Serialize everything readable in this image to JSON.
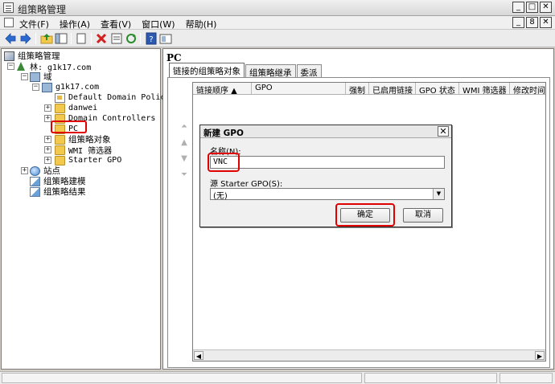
{
  "window": {
    "title": "组策略管理"
  },
  "menu": [
    "文件(F)",
    "操作(A)",
    "查看(V)",
    "窗口(W)",
    "帮助(H)"
  ],
  "window_buttons": {
    "minimize": "_",
    "maximize": "□",
    "close": "✕",
    "restore": "8"
  },
  "tree": {
    "root": "组策略管理",
    "forest": "林: g1k17.com",
    "domains": "域",
    "domain": "g1k17.com",
    "default_policy": "Default Domain Policy",
    "ou_danwei": "danwei",
    "ou_dc": "Domain Controllers",
    "ou_pc": "PC",
    "gpo_objects": "组策略对象",
    "wmi_filters": "WMI 筛选器",
    "starter_gpo": "Starter GPO",
    "sites": "站点",
    "modeling": "组策略建模",
    "results": "组策略结果",
    "expand_plus": "+",
    "expand_minus": "−"
  },
  "right": {
    "title": "PC",
    "tabs": [
      "链接的组策略对象",
      "组策略继承",
      "委派"
    ],
    "columns": [
      "链接顺序 ▲",
      "GPO",
      "强制",
      "已启用链接",
      "GPO 状态",
      "WMI 筛选器",
      "修改时间"
    ]
  },
  "dialog": {
    "title": "新建 GPO",
    "name_label": "名称(N):",
    "name_value": "VNC",
    "source_label": "源 Starter GPO(S):",
    "source_value": "(无)",
    "ok": "确定",
    "cancel": "取消",
    "close": "✕"
  },
  "icons": {
    "back": "back-arrow-icon",
    "forward": "forward-arrow-icon",
    "delete": "delete-icon",
    "refresh": "refresh-icon",
    "help": "help-icon"
  },
  "colors": {
    "highlight": "#e00000",
    "toolbar_back": "#2d6ad0",
    "delete": "#d02020"
  }
}
